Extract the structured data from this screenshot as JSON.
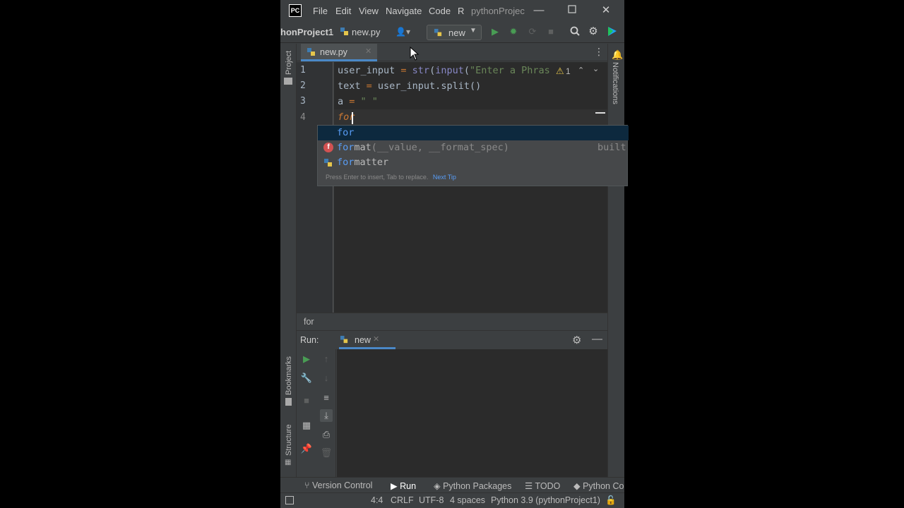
{
  "app": {
    "logo_text": "PC",
    "menu": [
      "File",
      "Edit",
      "View",
      "Navigate",
      "Code",
      "R"
    ],
    "window_title": "pythonProjec"
  },
  "navbar": {
    "project_crumb": "honProject1",
    "file_crumb": "new.py",
    "run_config": "new"
  },
  "stripes": {
    "project": "Project",
    "notifications": "Notifications",
    "bookmarks": "Bookmarks",
    "structure": "Structure"
  },
  "editor": {
    "tab_label": "new.py",
    "line_numbers": [
      "1",
      "2",
      "3",
      "4"
    ],
    "warning_count": "1",
    "lines": [
      {
        "segments": [
          [
            "user_input ",
            "#a9b7c6"
          ],
          [
            "= ",
            "#cc7832"
          ],
          [
            "str",
            "#8888c6"
          ],
          [
            "(",
            "#a9b7c6"
          ],
          [
            "input",
            "#8888c6"
          ],
          [
            "(",
            "#a9b7c6"
          ],
          [
            "\"Enter a Phras",
            "#6a8759"
          ]
        ]
      },
      {
        "segments": [
          [
            "text ",
            "#a9b7c6"
          ],
          [
            "= ",
            "#cc7832"
          ],
          [
            "user_input.",
            "#a9b7c6"
          ],
          [
            "split",
            "#a9b7c6"
          ],
          [
            "()",
            "#a9b7c6"
          ]
        ]
      },
      {
        "segments": [
          [
            "a ",
            "#a9b7c6"
          ],
          [
            "= ",
            "#cc7832"
          ],
          [
            "\" \"",
            "#6a8759"
          ]
        ]
      },
      {
        "segments": [
          [
            "for",
            "#cc7832"
          ]
        ]
      }
    ]
  },
  "completion": {
    "items": [
      {
        "match": "for",
        "rest": "",
        "tail": "",
        "type": ""
      },
      {
        "match": "for",
        "rest": "mat",
        "tail": "(__value, __format_spec)",
        "type": "built"
      },
      {
        "match": "for",
        "rest": "matter",
        "tail": "",
        "type": ""
      }
    ],
    "hint": "Press Enter to insert, Tab to replace.",
    "next_tip": "Next Tip"
  },
  "breadcrumb": "for",
  "run_panel": {
    "label": "Run:",
    "tab": "new"
  },
  "tool_buttons": [
    "Version Control",
    "Run",
    "Python Packages",
    "TODO",
    "Python Co"
  ],
  "status": {
    "position": "4:4",
    "line_sep": "CRLF",
    "encoding": "UTF-8",
    "indent": "4 spaces",
    "interpreter": "Python 3.9 (pythonProject1)"
  },
  "colors": {
    "accent": "#4a88c7",
    "run_green": "#499c54",
    "keyword": "#cc7832",
    "string": "#6a8759"
  }
}
